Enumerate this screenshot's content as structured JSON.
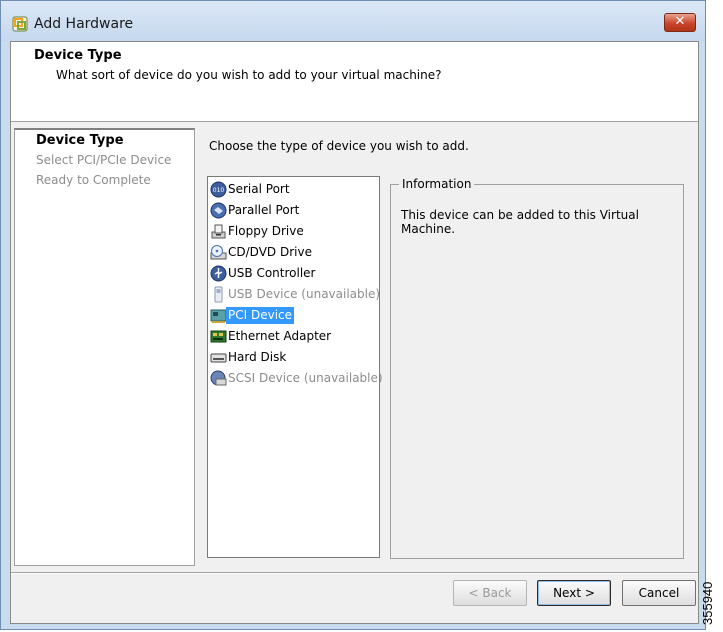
{
  "window": {
    "title": "Add Hardware",
    "close_glyph": "✕"
  },
  "header": {
    "title": "Device Type",
    "subtitle": "What sort of device do you wish to add to your virtual machine?"
  },
  "steps": [
    {
      "label": "Device Type",
      "state": "active"
    },
    {
      "label": "Select PCI/PCIe Device",
      "state": "inactive"
    },
    {
      "label": "Ready to Complete",
      "state": "inactive"
    }
  ],
  "instruction": "Choose the type of device you wish to add.",
  "devices": [
    {
      "label": "Serial Port",
      "icon": "serial-port-icon",
      "enabled": true,
      "selected": false
    },
    {
      "label": "Parallel Port",
      "icon": "parallel-port-icon",
      "enabled": true,
      "selected": false
    },
    {
      "label": "Floppy Drive",
      "icon": "floppy-drive-icon",
      "enabled": true,
      "selected": false
    },
    {
      "label": "CD/DVD Drive",
      "icon": "cd-dvd-drive-icon",
      "enabled": true,
      "selected": false
    },
    {
      "label": "USB Controller",
      "icon": "usb-controller-icon",
      "enabled": true,
      "selected": false
    },
    {
      "label": "USB Device (unavailable)",
      "icon": "usb-device-icon",
      "enabled": false,
      "selected": false
    },
    {
      "label": "PCI Device",
      "icon": "pci-device-icon",
      "enabled": true,
      "selected": true
    },
    {
      "label": "Ethernet Adapter",
      "icon": "ethernet-adapter-icon",
      "enabled": true,
      "selected": false
    },
    {
      "label": "Hard Disk",
      "icon": "hard-disk-icon",
      "enabled": true,
      "selected": false
    },
    {
      "label": "SCSI Device (unavailable)",
      "icon": "scsi-device-icon",
      "enabled": false,
      "selected": false
    }
  ],
  "info": {
    "legend": "Information",
    "text": "This device can be added to this Virtual Machine."
  },
  "buttons": {
    "back": "< Back",
    "next": "Next >",
    "cancel": "Cancel"
  },
  "figure_number": "355940",
  "colors": {
    "selection": "#3399ff",
    "title_bar": "#c9dbef",
    "close_button": "#c9452b"
  }
}
